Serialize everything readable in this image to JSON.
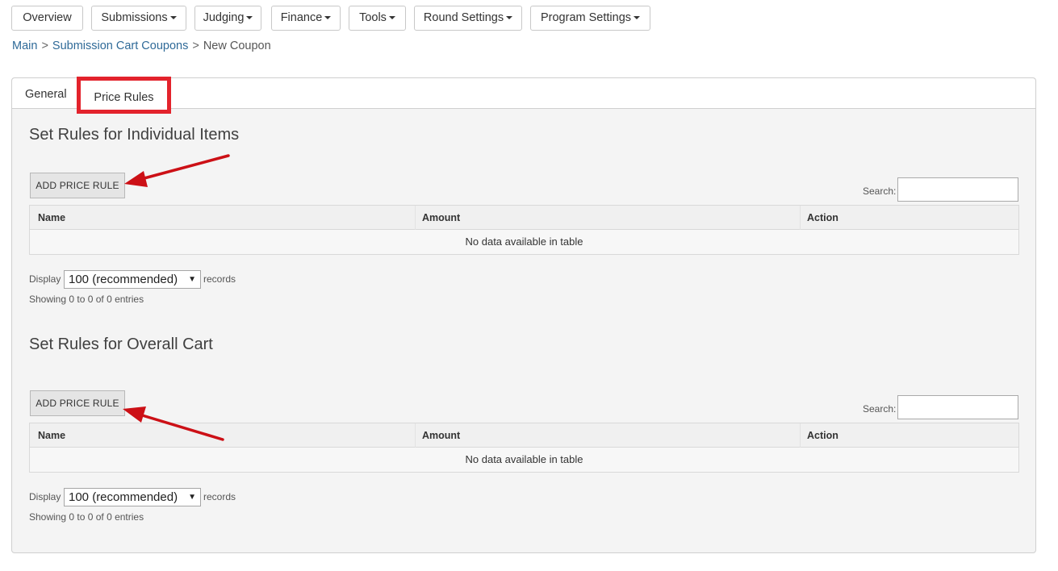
{
  "nav": {
    "items": [
      {
        "label": "Overview",
        "dropdown": false
      },
      {
        "label": "Submissions",
        "dropdown": true
      },
      {
        "label": "Judging",
        "dropdown": true
      },
      {
        "label": "Finance",
        "dropdown": true
      },
      {
        "label": "Tools",
        "dropdown": true
      },
      {
        "label": "Round Settings",
        "dropdown": true
      },
      {
        "label": "Program Settings",
        "dropdown": true
      }
    ]
  },
  "breadcrumb": {
    "main": "Main",
    "separator": ">",
    "coupons": "Submission Cart Coupons",
    "current": "New Coupon"
  },
  "tabs": {
    "general": "General",
    "price_rules": "Price Rules",
    "active": "price_rules"
  },
  "sections": [
    {
      "title": "Set Rules for Individual Items",
      "add_button": "ADD PRICE RULE",
      "search_label": "Search:",
      "search_value": "",
      "columns": [
        "Name",
        "Amount",
        "Action"
      ],
      "empty_text": "No data available in table",
      "display_label": "Display",
      "display_value": "100 (recommended)",
      "records_label": "records",
      "showing": "Showing 0 to 0 of 0 entries"
    },
    {
      "title": "Set Rules for Overall Cart",
      "add_button": "ADD PRICE RULE",
      "search_label": "Search:",
      "search_value": "",
      "columns": [
        "Name",
        "Amount",
        "Action"
      ],
      "empty_text": "No data available in table",
      "display_label": "Display",
      "display_value": "100 (recommended)",
      "records_label": "records",
      "showing": "Showing 0 to 0 of 0 entries"
    }
  ],
  "colors": {
    "annotation_red": "#cc1016",
    "highlight_box": "#e3232c",
    "link": "#2f6a98"
  }
}
